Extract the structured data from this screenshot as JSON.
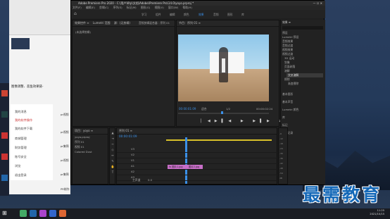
{
  "premiere": {
    "title": "Adobe Premiere Pro 2020 - C:\\用户\\Ktp\\文档\\Adobe\\Premiere Pro\\14.0\\yoyo.prproj *",
    "menu": [
      "文件(F)",
      "编辑(E)",
      "剪辑(C)",
      "序列(S)",
      "标记(M)",
      "图形(G)",
      "视图(V)",
      "窗口(W)",
      "帮助(H)"
    ],
    "workspaces": [
      "学习",
      "组件",
      "编辑",
      "颜色",
      "效果",
      "音频",
      "图形",
      "库"
    ],
    "active_workspace": "效果",
    "source_tabs": [
      "效果控件 ≡",
      "Lumetri 范围",
      "源：(无剪辑)",
      "音频剪辑混合器：序列 01"
    ],
    "source_msg": "(未选择剪辑)",
    "program_tab": "节目：序列 01 ≡",
    "program_tc_left": "00:00:01:09",
    "program_fit": "适合",
    "program_ratio": "1/2",
    "program_tc_right": "00:00:02:24",
    "effects_tab": "效果 ≡",
    "effects_items": [
      "预设",
      "Lumetri 预设",
      "音频效果",
      "音频过渡",
      "视频效果",
      "视频过渡",
      "3D 运动",
      "划像",
      "页面剥落",
      "溶解",
      "擦除"
    ],
    "effects_selected": "交叉溶解",
    "effects_sub": "渐变擦除",
    "right_sections": [
      "基本图形",
      "基本声音",
      "Lumetri 颜色",
      "库",
      "标记",
      "历史记录",
      "信息"
    ],
    "project_tab": "项目：yoyo ≡",
    "project_items": [
      "yoyo.prproj",
      "序列 01",
      "视频 01",
      "Colored Dust"
    ],
    "timeline_tab": "序列 01 ≡",
    "timeline_tc": "00:00:01:09",
    "tracks": [
      "V3",
      "V2",
      "V1",
      "A1",
      "A2",
      "A3"
    ],
    "master": "主声道",
    "master_val": "0.0",
    "clips": [
      "fx 图片1.jpg",
      "图片2.jpg"
    ],
    "meter_labels": [
      "-6",
      "-12",
      "-18",
      "-24",
      "-30",
      "-36",
      "-42",
      "-48",
      "-54",
      "dB"
    ]
  },
  "left_app": {
    "doc_text": "图像调整、恶鱼效果链-",
    "menu": [
      "我的消息",
      "我的软件操作",
      "我的软件下载",
      "商城管理",
      "财务管理",
      "账号安全",
      "浏览",
      "退出登录"
    ],
    "right_texts": [
      "pr视频",
      "pr视频",
      "pr集锦",
      "pr视频",
      "pr集锦",
      "PR制作"
    ]
  },
  "taskbar": {
    "time": "11:25",
    "date": "2021/10/15"
  },
  "watermark": "最需教育",
  "colors": {
    "accent": "#3b8fe6",
    "clip": "#c86ec8",
    "watermark": "#1569b8"
  }
}
